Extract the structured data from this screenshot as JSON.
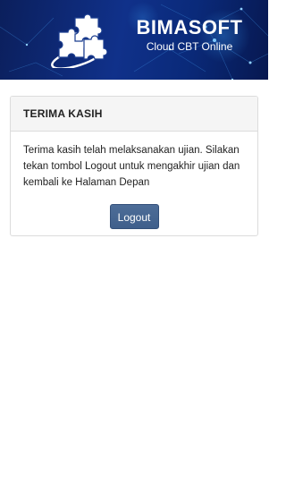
{
  "header": {
    "brand_title": "BIMASOFT",
    "brand_subtitle": "Cloud CBT Online",
    "logo_icon": "puzzle-globe-icon",
    "colors": {
      "bg_dark": "#0b1f5c",
      "bg_mid": "#10318a",
      "glow": "#4fb6ff"
    }
  },
  "panel": {
    "title": "TERIMA KASIH",
    "message": "Terima kasih telah melaksanakan ujian. Silakan tekan tombol Logout untuk mengakhir ujian dan kembali ke Halaman Depan",
    "logout_label": "Logout",
    "button_color": "#44648f"
  }
}
